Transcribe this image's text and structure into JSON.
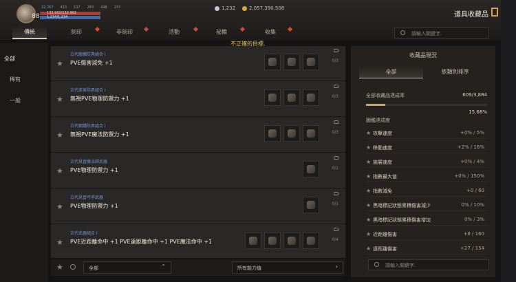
{
  "header": {
    "level": "88",
    "stats": [
      "32,767",
      "433",
      "537",
      "283",
      "498",
      "233"
    ],
    "hp_text": "132,902/132,902",
    "mp_text": "1,234/1,234",
    "currency_primary": "1,232",
    "currency_secondary": "2,057,390,508",
    "title": "道具收藏品"
  },
  "tabs": [
    {
      "label": "傳統"
    },
    {
      "label": "刻印"
    },
    {
      "label": "非刻印"
    },
    {
      "label": "活動"
    },
    {
      "label": "祕籍"
    },
    {
      "label": "收集"
    }
  ],
  "search": {
    "placeholder": "請輸入關鍵字."
  },
  "notice": "不正確的目標.",
  "leftnav": [
    {
      "label": "全部"
    },
    {
      "label": "稀有"
    },
    {
      "label": "一般"
    }
  ],
  "rows": [
    {
      "category": "古代龍鱗防具組合 I",
      "name": "PVE傷害減免 +1",
      "count": "0/3"
    },
    {
      "category": "古代皮革防具組合 I",
      "name": "無視PVE物理防禦力 +1",
      "count": "0/3"
    },
    {
      "category": "古代鋼鐵防具組合 I",
      "name": "無視PVE魔法防禦力 +1",
      "count": "0/3"
    },
    {
      "category": "古代見習魔法師武器",
      "name": "PVE物理防禦力 +1",
      "count": "0/1"
    },
    {
      "category": "古代見習弓手武器",
      "name": "PVE物理防禦力 +1",
      "count": "0/1"
    },
    {
      "category": "古代武器組合 I",
      "name": "PVE近距離命中 +1 PVE遠距離命中 +1 PVE魔法命中 +1",
      "count": "0/4"
    }
  ],
  "bottombar": {
    "select1": "全部",
    "select2": "所有能力值"
  },
  "panel": {
    "title": "收藏品現況",
    "tab_all": "全部",
    "tab_category": "依類別排序",
    "rate_label": "全部收藏品達成率",
    "rate_value": "609/3,884",
    "rate_percent": "15.68%",
    "group_label": "圖鑑達成度",
    "stats": [
      {
        "label": "攻擊速度",
        "value": "+0% / 5%"
      },
      {
        "label": "移動速度",
        "value": "+2% / 16%"
      },
      {
        "label": "施展速度",
        "value": "+0% / 4%"
      },
      {
        "label": "指數最大值",
        "value": "+0% / 150%"
      },
      {
        "label": "指數減免",
        "value": "+0 / 60"
      },
      {
        "label": "黑暗標記狀態累積傷害減少",
        "value": "0% / 10%"
      },
      {
        "label": "黑暗標記狀態累積傷害增加",
        "value": "0% / 3%"
      },
      {
        "label": "近距離傷害",
        "value": "+8 / 160"
      },
      {
        "label": "遠距離傷害",
        "value": "+27 / 154"
      }
    ]
  },
  "panel_search": {
    "placeholder": "請輸入關鍵字."
  }
}
